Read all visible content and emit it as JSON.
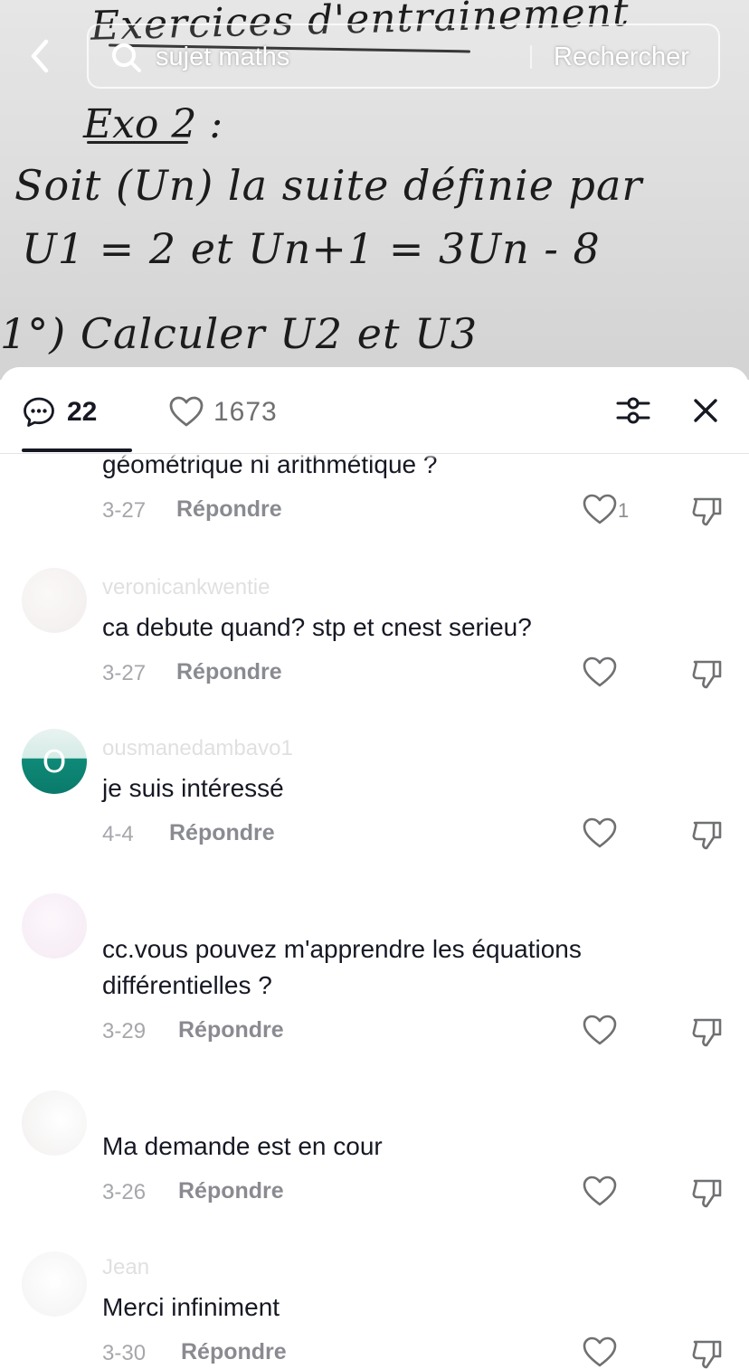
{
  "video": {
    "whiteboard_title": "Exercices d'entrainement",
    "exercise_label": "Exo 2 :",
    "line1": "Soit (Un) la suite définie par",
    "line2": "U1 = 2 et Un+1 = 3Un - 8",
    "line3": "1°) Calculer U2 et U3"
  },
  "search": {
    "query": "sujet maths",
    "submit_label": "Rechercher"
  },
  "header": {
    "comment_count": "22",
    "like_count": "1673"
  },
  "comments": [
    {
      "username": "",
      "text": "géométrique ni arithmétique ?",
      "date": "3-27",
      "reply_label": "Répondre",
      "likes": "1"
    },
    {
      "username": "veronicankwentie",
      "text": "ca debute quand? stp et cnest serieu?",
      "date": "3-27",
      "reply_label": "Répondre",
      "likes": ""
    },
    {
      "username": "ousmanedambavo1",
      "avatar_initial": "O",
      "text": "je suis intéressé",
      "date": "4-4",
      "reply_label": "Répondre",
      "likes": ""
    },
    {
      "username": "",
      "text": "cc.vous pouvez m'apprendre les équations différentielles ?",
      "date": "3-29",
      "reply_label": "Répondre",
      "likes": ""
    },
    {
      "username": "",
      "text": "Ma demande est en cour",
      "date": "3-26",
      "reply_label": "Répondre",
      "likes": ""
    },
    {
      "username": "Jean",
      "text": "Merci infiniment",
      "date": "3-30",
      "reply_label": "Répondre",
      "likes": ""
    }
  ],
  "colors": {
    "text_primary": "#161823",
    "text_secondary": "#8a8b91",
    "avatar_teal": "#0f8a78"
  }
}
